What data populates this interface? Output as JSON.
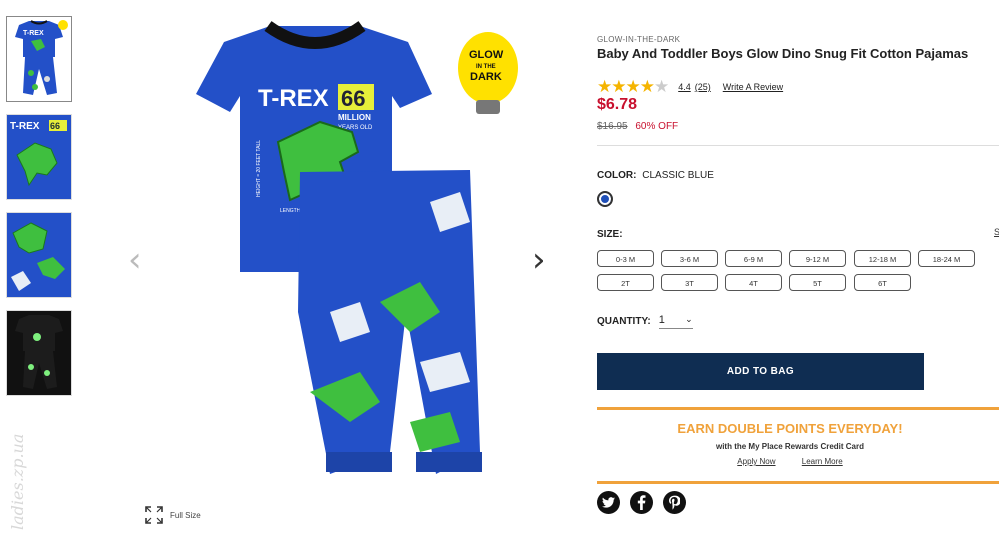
{
  "watermark": "ladies.zp.ua",
  "gallery": {
    "full_size_label": "Full Size",
    "glow_badge": [
      "GLOW",
      "IN THE",
      "DARK"
    ],
    "shirt_text": {
      "trex": "T-REX",
      "number": "66",
      "million": "MILLION",
      "years": "YEARS OLD",
      "height": "HEIGHT = 20 FEET TALL",
      "length": "LENGTH = 43 FEET LONG"
    }
  },
  "product": {
    "category": "GLOW-IN-THE-DARK",
    "title": "Baby And Toddler Boys Glow Dino Snug Fit Cotton Pajamas",
    "rating": 4.4,
    "rating_text": "4.4",
    "review_count": "(25)",
    "write_review": "Write A Review",
    "price": "$6.78",
    "original_price": "$16.95",
    "discount": "60% OFF"
  },
  "color": {
    "label": "COLOR:",
    "value": "CLASSIC BLUE",
    "swatch": "#1f4fb8"
  },
  "size": {
    "label": "SIZE:",
    "chart_link": "S",
    "options": [
      "0-3 M",
      "3-6 M",
      "6-9 M",
      "9-12 M",
      "12-18 M",
      "18-24 M",
      "2T",
      "3T",
      "4T",
      "5T",
      "6T"
    ]
  },
  "quantity": {
    "label": "QUANTITY:",
    "value": "1"
  },
  "add_to_bag": "ADD TO BAG",
  "promo": {
    "headline": "EARN DOUBLE POINTS EVERYDAY!",
    "subtext": "with the My Place Rewards Credit Card",
    "apply_now": "Apply Now",
    "learn_more": "Learn More"
  },
  "social": [
    "twitter-icon",
    "facebook-icon",
    "pinterest-icon"
  ],
  "colors": {
    "accent_red": "#c8102e",
    "navy": "#0f2d52",
    "promo_orange": "#f0a23b",
    "star": "#f5b400"
  }
}
